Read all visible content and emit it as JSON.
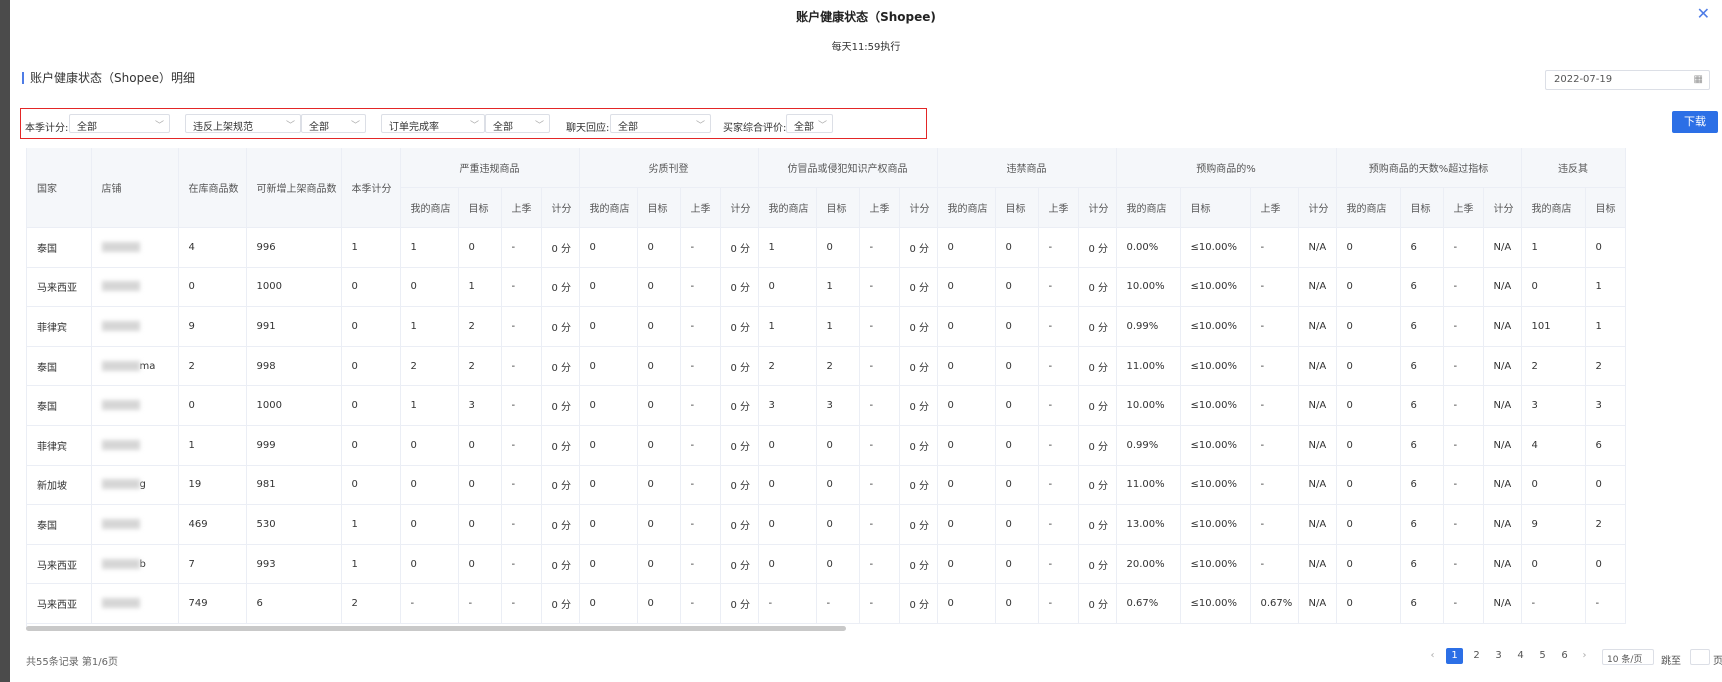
{
  "modal": {
    "title": "账户健康状态（Shopee)",
    "subtitle": "每天11:59执行",
    "close_icon": "close-icon"
  },
  "section_title": "账户健康状态（Shopee）明细",
  "date_picker": {
    "value": "2022-07-19",
    "icon": "calendar-icon"
  },
  "filters": {
    "season_label": "本季计分:",
    "season_value": "全部",
    "rule_select": "违反上架规范",
    "rule_value": "全部",
    "order_select": "订单完成率",
    "order_value": "全部",
    "chat_label": "聊天回应:",
    "chat_value": "全部",
    "rating_label": "买家综合评价:",
    "rating_value": "全部"
  },
  "download_label": "下载",
  "table": {
    "fixed_headers": [
      "国家",
      "店铺",
      "在库商品数",
      "可新增上架商品数",
      "本季计分"
    ],
    "groups": [
      "严重违规商品",
      "劣质刊登",
      "仿冒品或侵犯知识产权商品",
      "违禁商品",
      "预购商品的%",
      "预购商品的天数%超过指标",
      "违反其"
    ],
    "sub_headers": [
      "我的商店",
      "目标",
      "上季",
      "计分"
    ],
    "rows": [
      {
        "country": "泰国",
        "store": "",
        "stock": "4",
        "new": "996",
        "score": "1",
        "g": [
          [
            "1",
            "0",
            "-",
            "0 分"
          ],
          [
            "0",
            "0",
            "-",
            "0 分"
          ],
          [
            "1",
            "0",
            "-",
            "0 分"
          ],
          [
            "0",
            "0",
            "-",
            "0 分"
          ],
          [
            "0.00%",
            "≤10.00%",
            "-",
            "N/A"
          ],
          [
            "0",
            "6",
            "-",
            "N/A"
          ],
          [
            "1",
            "0"
          ]
        ]
      },
      {
        "country": "马来西亚",
        "store": "",
        "stock": "0",
        "new": "1000",
        "score": "0",
        "g": [
          [
            "0",
            "1",
            "-",
            "0 分"
          ],
          [
            "0",
            "0",
            "-",
            "0 分"
          ],
          [
            "0",
            "1",
            "-",
            "0 分"
          ],
          [
            "0",
            "0",
            "-",
            "0 分"
          ],
          [
            "10.00%",
            "≤10.00%",
            "-",
            "N/A"
          ],
          [
            "0",
            "6",
            "-",
            "N/A"
          ],
          [
            "0",
            "1"
          ]
        ]
      },
      {
        "country": "菲律宾",
        "store": "",
        "stock": "9",
        "new": "991",
        "score": "0",
        "g": [
          [
            "1",
            "2",
            "-",
            "0 分"
          ],
          [
            "0",
            "0",
            "-",
            "0 分"
          ],
          [
            "1",
            "1",
            "-",
            "0 分"
          ],
          [
            "0",
            "0",
            "-",
            "0 分"
          ],
          [
            "0.99%",
            "≤10.00%",
            "-",
            "N/A"
          ],
          [
            "0",
            "6",
            "-",
            "N/A"
          ],
          [
            "101",
            "1"
          ]
        ]
      },
      {
        "country": "泰国",
        "store": "ma",
        "stock": "2",
        "new": "998",
        "score": "0",
        "g": [
          [
            "2",
            "2",
            "-",
            "0 分"
          ],
          [
            "0",
            "0",
            "-",
            "0 分"
          ],
          [
            "2",
            "2",
            "-",
            "0 分"
          ],
          [
            "0",
            "0",
            "-",
            "0 分"
          ],
          [
            "11.00%",
            "≤10.00%",
            "-",
            "N/A"
          ],
          [
            "0",
            "6",
            "-",
            "N/A"
          ],
          [
            "2",
            "2"
          ]
        ]
      },
      {
        "country": "泰国",
        "store": "",
        "stock": "0",
        "new": "1000",
        "score": "0",
        "g": [
          [
            "1",
            "3",
            "-",
            "0 分"
          ],
          [
            "0",
            "0",
            "-",
            "0 分"
          ],
          [
            "3",
            "3",
            "-",
            "0 分"
          ],
          [
            "0",
            "0",
            "-",
            "0 分"
          ],
          [
            "10.00%",
            "≤10.00%",
            "-",
            "N/A"
          ],
          [
            "0",
            "6",
            "-",
            "N/A"
          ],
          [
            "3",
            "3"
          ]
        ]
      },
      {
        "country": "菲律宾",
        "store": "",
        "stock": "1",
        "new": "999",
        "score": "0",
        "g": [
          [
            "0",
            "0",
            "-",
            "0 分"
          ],
          [
            "0",
            "0",
            "-",
            "0 分"
          ],
          [
            "0",
            "0",
            "-",
            "0 分"
          ],
          [
            "0",
            "0",
            "-",
            "0 分"
          ],
          [
            "0.99%",
            "≤10.00%",
            "-",
            "N/A"
          ],
          [
            "0",
            "6",
            "-",
            "N/A"
          ],
          [
            "4",
            "6"
          ]
        ]
      },
      {
        "country": "新加坡",
        "store": "g",
        "stock": "19",
        "new": "981",
        "score": "0",
        "g": [
          [
            "0",
            "0",
            "-",
            "0 分"
          ],
          [
            "0",
            "0",
            "-",
            "0 分"
          ],
          [
            "0",
            "0",
            "-",
            "0 分"
          ],
          [
            "0",
            "0",
            "-",
            "0 分"
          ],
          [
            "11.00%",
            "≤10.00%",
            "-",
            "N/A"
          ],
          [
            "0",
            "6",
            "-",
            "N/A"
          ],
          [
            "0",
            "0"
          ]
        ]
      },
      {
        "country": "泰国",
        "store": "",
        "stock": "469",
        "new": "530",
        "score": "1",
        "g": [
          [
            "0",
            "0",
            "-",
            "0 分"
          ],
          [
            "0",
            "0",
            "-",
            "0 分"
          ],
          [
            "0",
            "0",
            "-",
            "0 分"
          ],
          [
            "0",
            "0",
            "-",
            "0 分"
          ],
          [
            "13.00%",
            "≤10.00%",
            "-",
            "N/A"
          ],
          [
            "0",
            "6",
            "-",
            "N/A"
          ],
          [
            "9",
            "2"
          ]
        ]
      },
      {
        "country": "马来西亚",
        "store": "b",
        "stock": "7",
        "new": "993",
        "score": "1",
        "g": [
          [
            "0",
            "0",
            "-",
            "0 分"
          ],
          [
            "0",
            "0",
            "-",
            "0 分"
          ],
          [
            "0",
            "0",
            "-",
            "0 分"
          ],
          [
            "0",
            "0",
            "-",
            "0 分"
          ],
          [
            "20.00%",
            "≤10.00%",
            "-",
            "N/A"
          ],
          [
            "0",
            "6",
            "-",
            "N/A"
          ],
          [
            "0",
            "0"
          ]
        ]
      },
      {
        "country": "马来西亚",
        "store": "",
        "stock": "749",
        "new": "6",
        "score": "2",
        "g": [
          [
            "-",
            "-",
            "-",
            "0 分"
          ],
          [
            "0",
            "0",
            "-",
            "0 分"
          ],
          [
            "-",
            "-",
            "-",
            "0 分"
          ],
          [
            "0",
            "0",
            "-",
            "0 分"
          ],
          [
            "0.67%",
            "≤10.00%",
            "0.67%",
            "N/A"
          ],
          [
            "0",
            "6",
            "-",
            "N/A"
          ],
          [
            "-",
            "-"
          ]
        ]
      }
    ]
  },
  "footer": {
    "summary": "共55条记录 第1/6页",
    "pages": [
      "1",
      "2",
      "3",
      "4",
      "5",
      "6"
    ],
    "prev_icon": "‹",
    "next_icon": "›",
    "page_size": "10 条/页",
    "jump_label": "跳至",
    "page_suffix": "页"
  }
}
